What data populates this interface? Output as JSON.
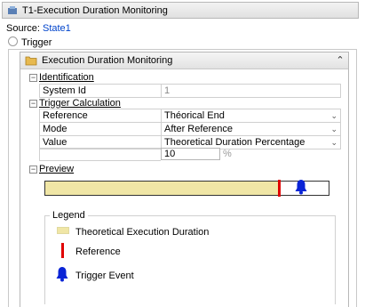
{
  "window": {
    "title": "T1-Execution Duration Monitoring"
  },
  "source": {
    "label": "Source:",
    "value": "State1"
  },
  "trigger": {
    "label": "Trigger"
  },
  "panel": {
    "title": "Execution Duration Monitoring"
  },
  "identification": {
    "header": "Identification",
    "rows": [
      {
        "label": "System Id",
        "value": "1"
      }
    ]
  },
  "trigger_calculation": {
    "header": "Trigger Calculation",
    "rows": [
      {
        "label": "Reference",
        "value": "Théorical End"
      },
      {
        "label": "Mode",
        "value": "After Reference"
      },
      {
        "label": "Value",
        "value": "Theoretical Duration Percentage"
      }
    ],
    "amount": "10",
    "unit": "%"
  },
  "preview": {
    "header": "Preview",
    "duration_fraction": 0.82,
    "legend_title": "Legend",
    "legend": [
      "Theoretical Execution Duration",
      "Reference",
      "Trigger Event"
    ]
  },
  "colors": {
    "duration": "#f0e6a6",
    "reference": "#e00000",
    "trigger": "#0a24d6"
  },
  "icons": [
    "app-icon",
    "folder-icon",
    "collapse-up-icon",
    "dropdown-arrow-icon",
    "bell-icon"
  ]
}
